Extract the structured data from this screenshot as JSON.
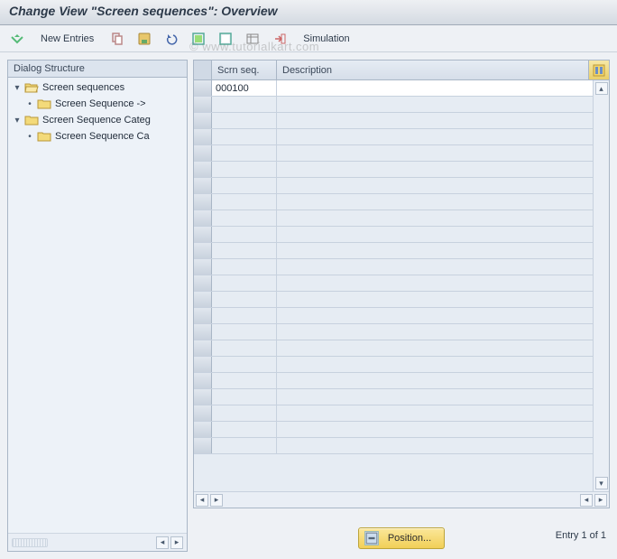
{
  "title": "Change View \"Screen sequences\": Overview",
  "watermark": "© www.tutorialkart.com",
  "toolbar": {
    "new_entries_label": "New Entries",
    "simulation_label": "Simulation",
    "icons": [
      "expand",
      "copy",
      "save",
      "undo",
      "select-all",
      "deselect-all",
      "table-settings",
      "export"
    ]
  },
  "dialog_structure": {
    "header": "Dialog Structure",
    "nodes": [
      {
        "label": "Screen sequences",
        "level": 0,
        "expanded": true,
        "open": true
      },
      {
        "label": "Screen Sequence ->",
        "level": 1,
        "expanded": false,
        "open": false
      },
      {
        "label": "Screen Sequence Categ",
        "level": 0,
        "expanded": true,
        "open": false
      },
      {
        "label": "Screen Sequence Ca",
        "level": 1,
        "expanded": false,
        "open": false
      }
    ]
  },
  "table": {
    "columns": {
      "col1": "Scrn seq.",
      "col2": "Description"
    },
    "rows": [
      {
        "scrn_seq": "000100",
        "description": ""
      }
    ],
    "blank_row_count": 22
  },
  "footer": {
    "position_label": "Position...",
    "entry_text": "Entry 1 of 1"
  }
}
